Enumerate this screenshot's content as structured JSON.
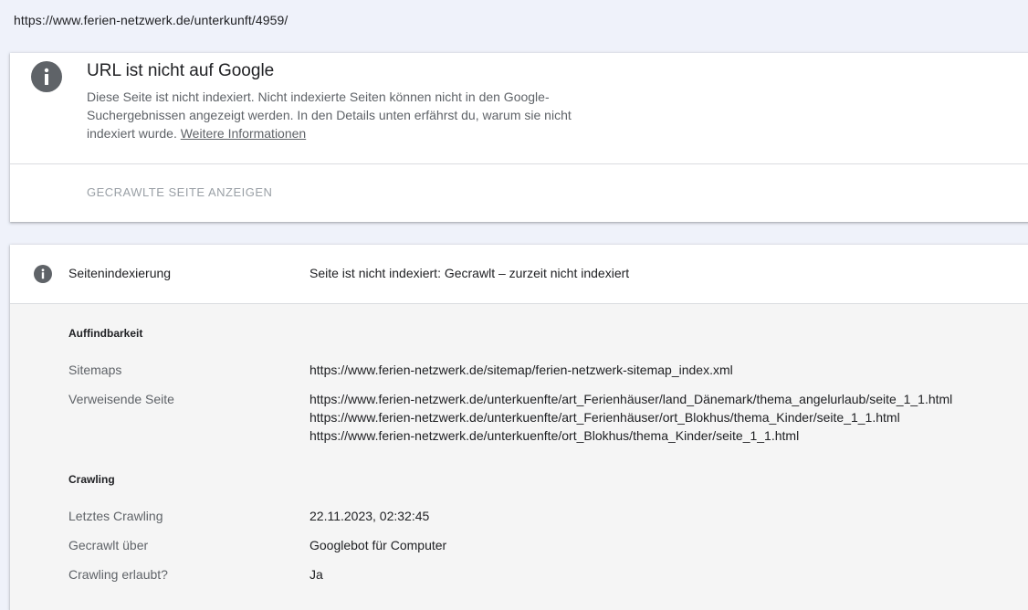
{
  "url": "https://www.ferien-netzwerk.de/unterkunft/4959/",
  "status_card": {
    "title": "URL ist nicht auf Google",
    "description_lines": [
      "Diese Seite ist nicht indexiert. Nicht indexierte Seiten können nicht in den Google-",
      "Suchergebnissen angezeigt werden. In den Details unten erfährst du, warum sie nicht",
      "indexiert wurde."
    ],
    "more_info_link": "Weitere Informationen",
    "crawl_button": "GECRAWLTE SEITE ANZEIGEN"
  },
  "indexing": {
    "label": "Seitenindexierung",
    "value": "Seite ist nicht indexiert: Gecrawlt – zurzeit nicht indexiert"
  },
  "discoverability": {
    "heading": "Auffindbarkeit",
    "sitemaps_label": "Sitemaps",
    "sitemaps_value": "https://www.ferien-netzwerk.de/sitemap/ferien-netzwerk-sitemap_index.xml",
    "referring_label": "Verweisende Seite",
    "referring_pages": [
      "https://www.ferien-netzwerk.de/unterkuenfte/art_Ferienhäuser/land_Dänemark/thema_angelurlaub/seite_1_1.html",
      "https://www.ferien-netzwerk.de/unterkuenfte/art_Ferienhäuser/ort_Blokhus/thema_Kinder/seite_1_1.html",
      "https://www.ferien-netzwerk.de/unterkuenfte/ort_Blokhus/thema_Kinder/seite_1_1.html"
    ]
  },
  "crawling": {
    "heading": "Crawling",
    "last_crawl_label": "Letztes Crawling",
    "last_crawl_value": "22.11.2023, 02:32:45",
    "crawled_via_label": "Gecrawlt über",
    "crawled_via_value": "Googlebot für Computer",
    "crawl_allowed_label": "Crawling erlaubt?",
    "crawl_allowed_value": "Ja"
  },
  "icons": {
    "status": "info-icon",
    "indexing": "info-icon"
  },
  "colors": {
    "background": "#eff2fa",
    "icon": "#5f6368",
    "muted_text": "#5f6368",
    "disabled_button": "#9aa0a6"
  }
}
